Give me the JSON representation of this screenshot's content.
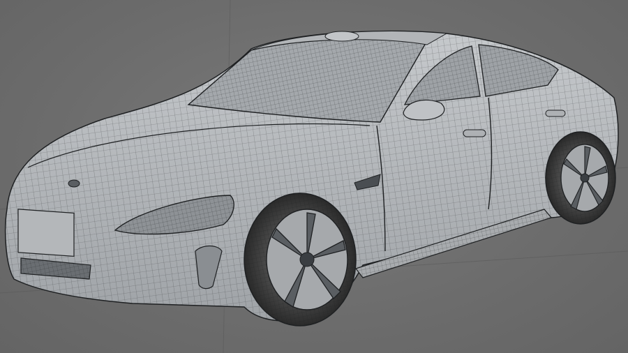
{
  "viewport": {
    "background_color": "#6e6e6e",
    "grid_line_color": "#5a5a5a"
  },
  "model": {
    "subject": "car",
    "display_mode": "wireframe-on-shaded",
    "body_color": "#b9bcbf",
    "wire_color": "#2a2c2e",
    "glass_color": "#9ea2a6",
    "tire_color": "#3a3a3a",
    "rim_color": "#a6a9ac"
  }
}
